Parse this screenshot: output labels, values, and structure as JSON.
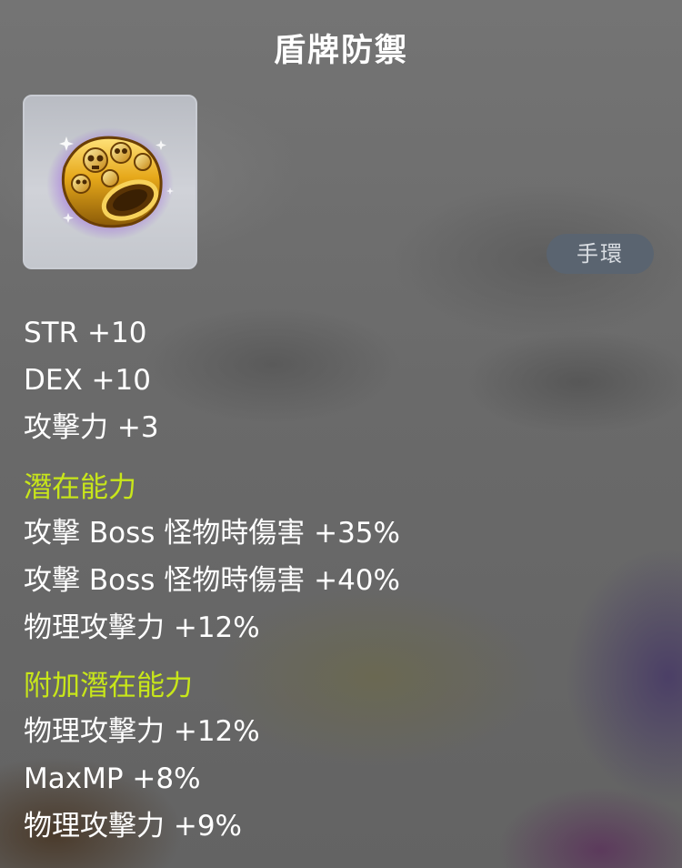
{
  "item": {
    "title": "盾牌防禦",
    "type_badge": "手環",
    "icon": "golden-skull-bracelet-icon"
  },
  "base_stats": [
    "STR +10",
    "DEX +10",
    "攻擊力 +3"
  ],
  "potential": {
    "heading": "潛在能力",
    "heading_color": "#c8e61a",
    "lines": [
      "攻擊 Boss 怪物時傷害 +35%",
      "攻擊 Boss 怪物時傷害 +40%",
      "物理攻擊力 +12%"
    ]
  },
  "additional_potential": {
    "heading": "附加潛在能力",
    "heading_color": "#c8e61a",
    "lines": [
      "物理攻擊力 +12%",
      "MaxMP +8%",
      "物理攻擊力 +9%"
    ]
  }
}
